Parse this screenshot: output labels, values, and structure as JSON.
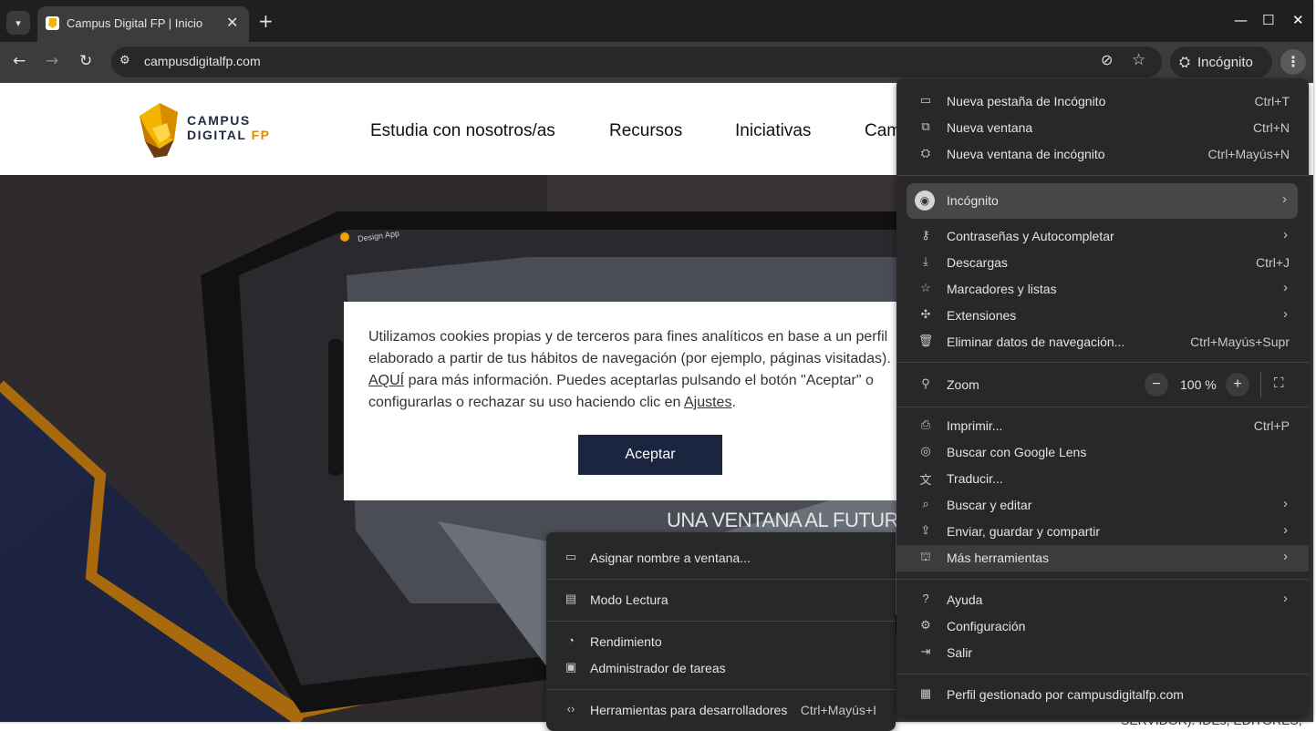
{
  "browser": {
    "tab_title": "Campus Digital FP | Inicio",
    "url": "campusdigitalfp.com",
    "incognito_label": "Incógnito",
    "icons": {
      "tab_search": "chevron-down-icon",
      "close": "close-icon",
      "new_tab": "plus-icon",
      "back": "arrow-left-icon",
      "forward": "arrow-right-icon",
      "reload": "reload-icon",
      "site_info": "tune-icon",
      "eye_off": "eye-off-icon",
      "bookmark": "star-icon",
      "menu": "kebab-icon"
    }
  },
  "site": {
    "logo_line1": "CAMPUS",
    "logo_line2a": "DIGITAL ",
    "logo_line2b": "FP",
    "nav": [
      "Estudia con nosotros/as",
      "Recursos",
      "Iniciativas",
      "Cam"
    ],
    "tagline": "UNA VENTANA AL FUTUR",
    "device_label": "Design App",
    "behind_text": "SERVIDOR). IDEs, EDITORES,"
  },
  "cookie": {
    "text_1": "Utilizamos cookies propias y de terceros para fines analíticos en base a un perfil elaborado a partir de tus hábitos de navegación (por ejemplo, páginas visitadas). ",
    "link_here": "AQUÍ",
    "text_2": " para más información. Puedes aceptarlas pulsando el botón \"Aceptar\" o configurarlas o rechazar su uso haciendo clic en ",
    "link_settings": "Ajustes",
    "text_3": ".",
    "accept": "Aceptar"
  },
  "menu": {
    "new_tab": {
      "label": "Nueva pestaña de Incógnito",
      "shortcut": "Ctrl+T"
    },
    "new_window": {
      "label": "Nueva ventana",
      "shortcut": "Ctrl+N"
    },
    "new_incognito": {
      "label": "Nueva ventana de incógnito",
      "shortcut": "Ctrl+Mayús+N"
    },
    "profile": {
      "label": "Incógnito"
    },
    "passwords": {
      "label": "Contraseñas y Autocompletar"
    },
    "downloads": {
      "label": "Descargas",
      "shortcut": "Ctrl+J"
    },
    "bookmarks": {
      "label": "Marcadores y listas"
    },
    "extensions": {
      "label": "Extensiones"
    },
    "clear_data": {
      "label": "Eliminar datos de navegación...",
      "shortcut": "Ctrl+Mayús+Supr"
    },
    "zoom": {
      "label": "Zoom",
      "minus": "−",
      "value": "100 %",
      "plus": "+"
    },
    "print": {
      "label": "Imprimir...",
      "shortcut": "Ctrl+P"
    },
    "lens": {
      "label": "Buscar con Google Lens"
    },
    "translate": {
      "label": "Traducir..."
    },
    "find_edit": {
      "label": "Buscar y editar"
    },
    "send_save": {
      "label": "Enviar, guardar y compartir"
    },
    "more_tools": {
      "label": "Más herramientas"
    },
    "help": {
      "label": "Ayuda"
    },
    "settings": {
      "label": "Configuración"
    },
    "exit": {
      "label": "Salir"
    },
    "managed": {
      "label": "Perfil gestionado por campusdigitalfp.com"
    }
  },
  "submenu": {
    "name_window": {
      "label": "Asignar nombre a ventana..."
    },
    "reading_mode": {
      "label": "Modo Lectura"
    },
    "performance": {
      "label": "Rendimiento"
    },
    "task_manager": {
      "label": "Administrador de tareas"
    },
    "devtools": {
      "label": "Herramientas para desarrolladores",
      "shortcut": "Ctrl+Mayús+I"
    }
  },
  "colors": {
    "chrome_dark": "#1f1f1f",
    "toolbar": "#3c3c3c",
    "menu_bg": "#282828",
    "brand_navy": "#1b2540",
    "brand_gold": "#d98c00"
  }
}
